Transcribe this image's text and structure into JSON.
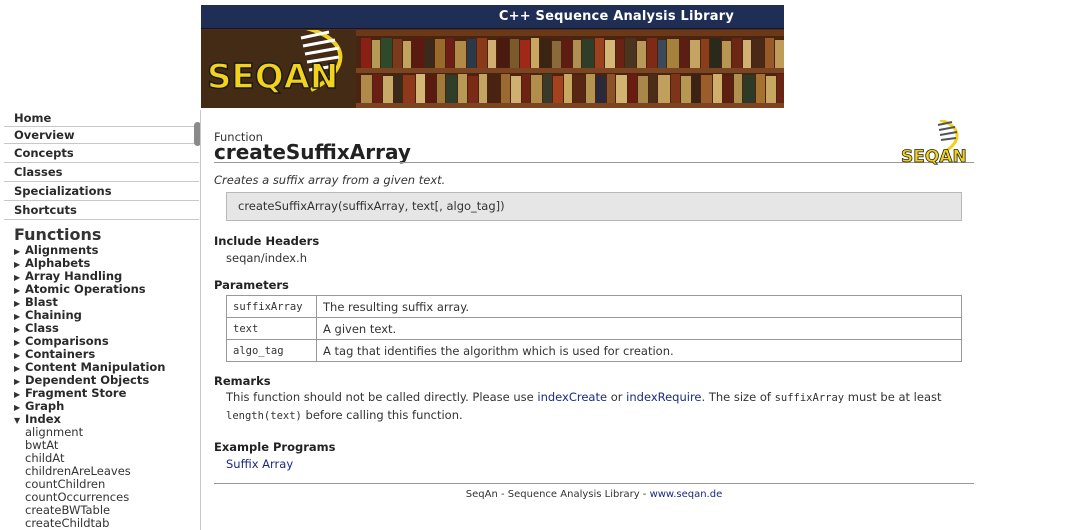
{
  "banner": {
    "title": "C++ Sequence Analysis Library",
    "logo_text": "SEQAN"
  },
  "sidebar": {
    "nav": [
      {
        "label": "Home"
      },
      {
        "label": "Overview"
      },
      {
        "label": "Concepts"
      },
      {
        "label": "Classes"
      },
      {
        "label": "Specializations"
      },
      {
        "label": "Shortcuts"
      }
    ],
    "heading": "Functions",
    "categories": [
      "Alignments",
      "Alphabets",
      "Array Handling",
      "Atomic Operations",
      "Blast",
      "Chaining",
      "Class",
      "Comparisons",
      "Containers",
      "Content Manipulation",
      "Dependent Objects",
      "Fragment Store",
      "Graph"
    ],
    "expanded_category": "Index",
    "index_items": [
      "alignment",
      "bwtAt",
      "childAt",
      "childrenAreLeaves",
      "countChildren",
      "countOccurrences",
      "createBWTable",
      "createChildtab"
    ]
  },
  "main": {
    "entity_type": "Function",
    "title": "createSuffixArray",
    "logo_text": "SEQAN",
    "summary": "Creates a suffix array from a given text.",
    "signature": "createSuffixArray(suffixArray, text[, algo_tag])",
    "include_heading": "Include Headers",
    "include_value": "seqan/index.h",
    "params_heading": "Parameters",
    "params": [
      {
        "name": "suffixArray",
        "desc": "The resulting suffix array."
      },
      {
        "name": "text",
        "desc": "A given text."
      },
      {
        "name": "algo_tag",
        "desc": "A tag that identifies the algorithm which is used for creation."
      }
    ],
    "remarks_heading": "Remarks",
    "remarks": {
      "part1": "This function should not be called directly. Please use ",
      "link1": "indexCreate",
      "part2": " or ",
      "link2": "indexRequire",
      "part3": ". The size of ",
      "code1": "suffixArray",
      "part4": " must be at least ",
      "code2": "length(text)",
      "part5": " before calling this function."
    },
    "examples_heading": "Example Programs",
    "example_link": "Suffix Array"
  },
  "footer": {
    "text": "SeqAn - Sequence Analysis Library - ",
    "link": "www.seqan.de"
  },
  "colors": {
    "banner_bar": "#1f2e55",
    "link": "#1a2a80",
    "logo_yellow": "#f2d21b",
    "signature_bg": "#e6e6e6"
  }
}
